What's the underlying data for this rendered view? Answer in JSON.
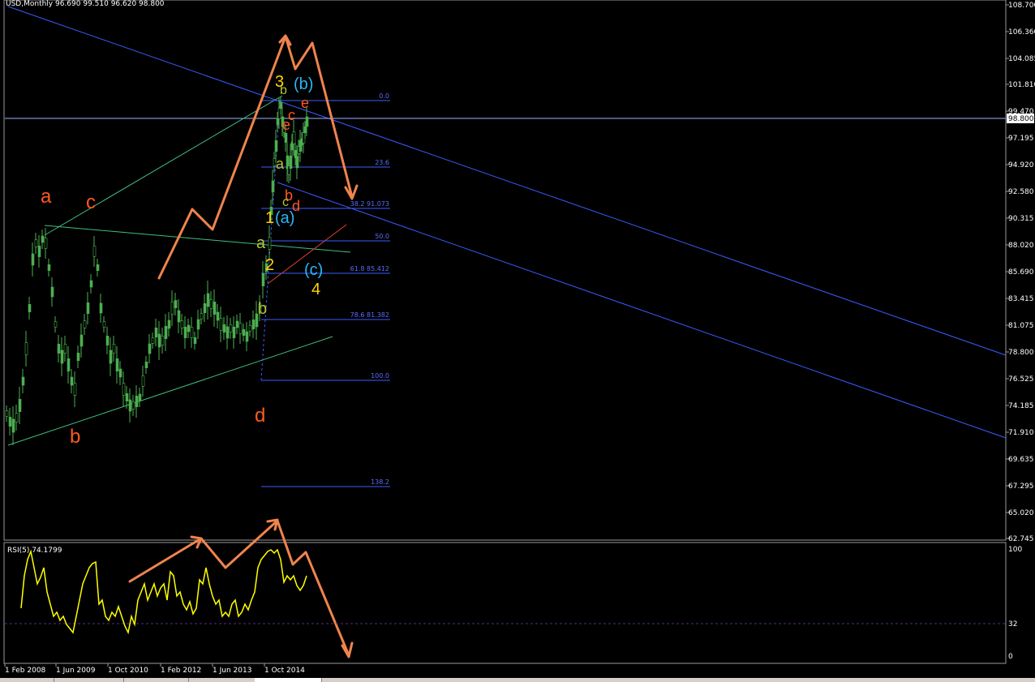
{
  "window": {
    "header": "USD,Monthly  96.690 99.510 96.620 98.800"
  },
  "price_axis": {
    "labels": [
      "108.700",
      "106.360",
      "104.085",
      "101.810",
      "99.470",
      "98.800",
      "97.195",
      "94.920",
      "92.580",
      "90.315",
      "88.020",
      "85.690",
      "83.415",
      "81.075",
      "78.800",
      "76.525",
      "74.185",
      "71.910",
      "69.635",
      "67.295",
      "65.020",
      "62.745"
    ],
    "current_price": "98.800"
  },
  "time_axis": {
    "labels": [
      "1 Feb 2008",
      "1 Jun 2009",
      "1 Oct 2010",
      "1 Feb 2012",
      "1 Jun 2013",
      "1 Oct 2014"
    ]
  },
  "fib_levels": [
    {
      "label": "0.0"
    },
    {
      "label": "23.6"
    },
    {
      "label": "38.2 91.073"
    },
    {
      "label": "50.0"
    },
    {
      "label": "61.8 85.412"
    },
    {
      "label": "78.6 81.382"
    },
    {
      "label": "100.0"
    },
    {
      "label": "138.2"
    }
  ],
  "wave_labels": {
    "a_big": "a",
    "b_big": "b",
    "c_big": "c",
    "d_big": "d",
    "one": "1",
    "two": "2",
    "three": "3",
    "four": "4",
    "wa": "(a)",
    "wb": "(b)",
    "wc": "(c)",
    "small_a1": "a",
    "small_b1": "b",
    "small_a2": "a",
    "small_b2": "b",
    "small_c": "c",
    "small_d": "d",
    "small_e": "e",
    "small_c2": "c",
    "small_e2": "e",
    "small_c3": "c"
  },
  "rsi": {
    "label": "RSI(5) 74.1799",
    "axis": [
      "100",
      "32",
      "0"
    ]
  },
  "colors": {
    "bg": "#000000",
    "candles": "#4caf50",
    "channel": "#3b5bff",
    "triangle": "#3fbf7f",
    "arrows": "#f0844c",
    "rsi_line": "#ffff00",
    "wave_orange": "#ff5a1f",
    "wave_yellow": "#ffd400",
    "wave_cyan": "#29b6f6",
    "wave_olive": "#b5c431"
  }
}
